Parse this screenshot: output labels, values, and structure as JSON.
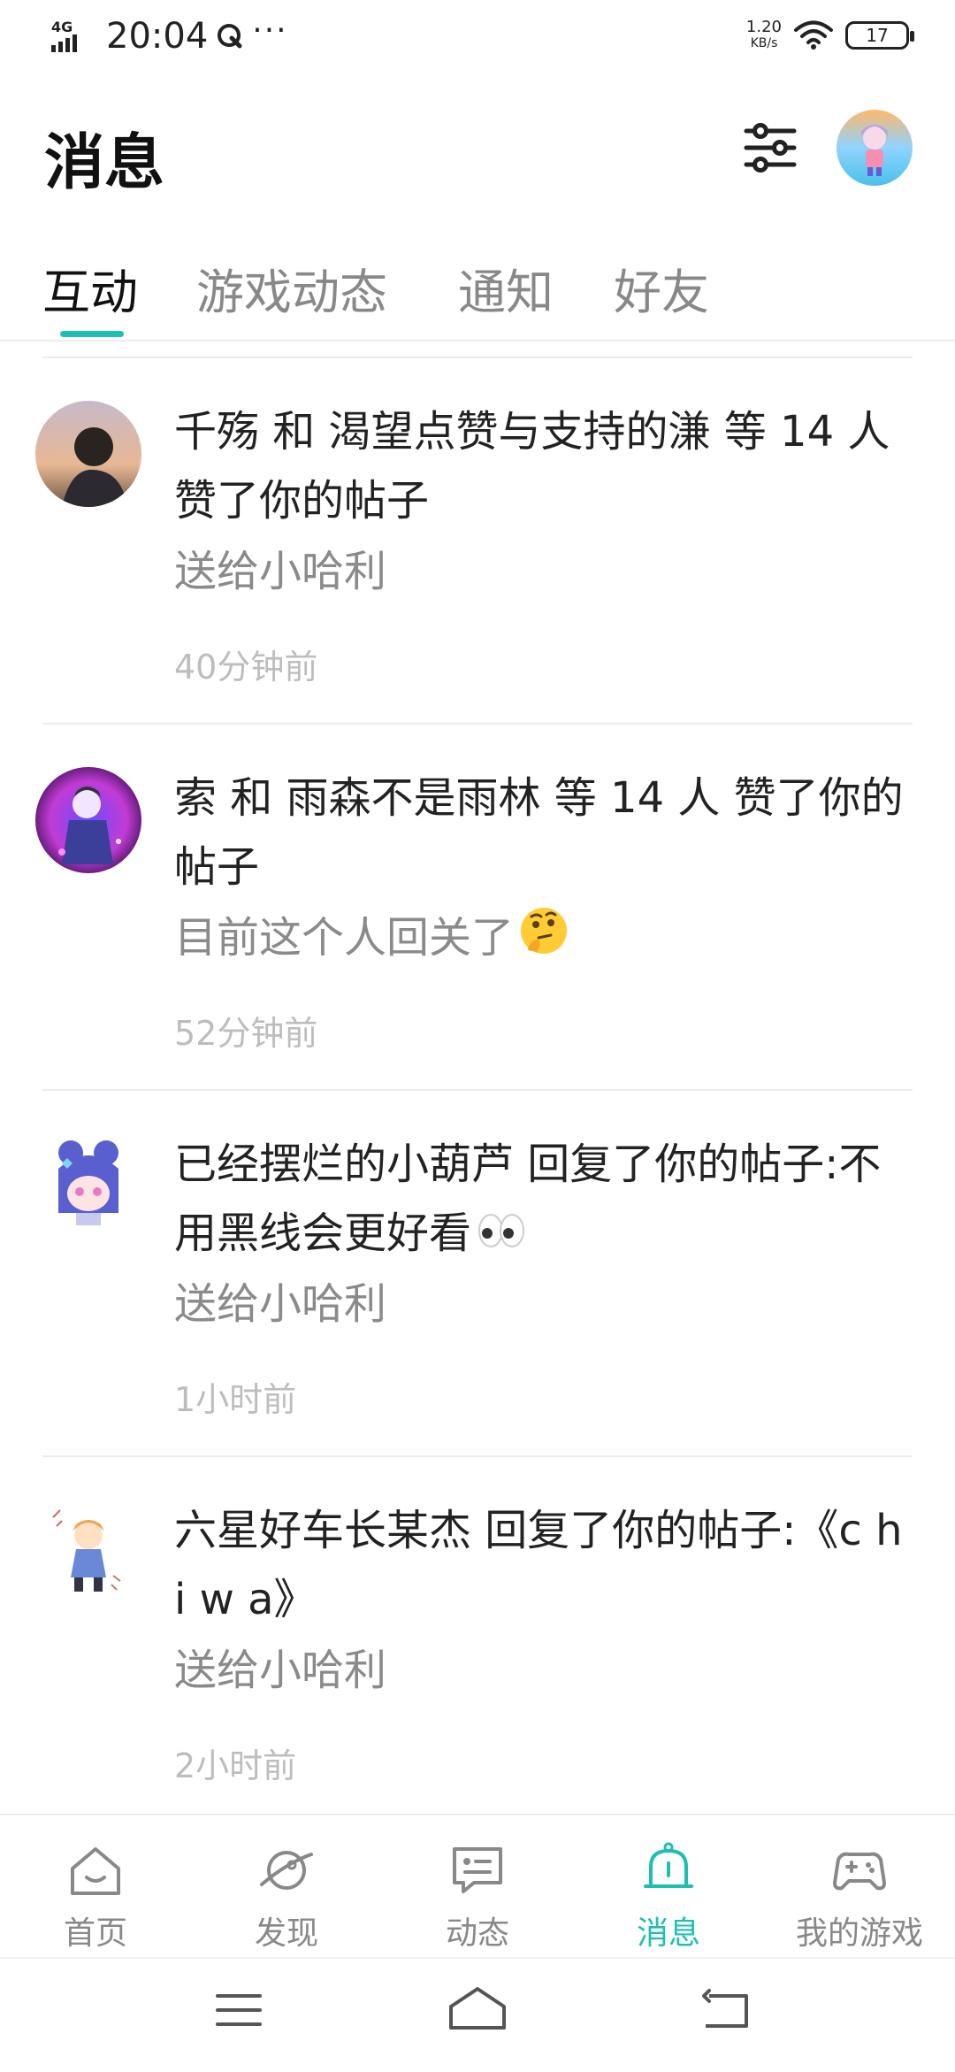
{
  "status_bar": {
    "network": "4G",
    "time": "20:04",
    "more": "···",
    "speed_value": "1.20",
    "speed_unit": "KB/s",
    "battery": "17"
  },
  "header": {
    "title": "消息"
  },
  "tabs": [
    {
      "label": "互动",
      "active": true
    },
    {
      "label": "游戏动态",
      "active": false
    },
    {
      "label": "通知",
      "active": false
    },
    {
      "label": "好友",
      "active": false
    }
  ],
  "messages": [
    {
      "title": "千殇 和 渴望点赞与支持的溓 等 14 人 赞了你的帖子",
      "subtitle": "送给小哈利",
      "time": "40分钟前"
    },
    {
      "title": "索 和 雨森不是雨林 等 14 人 赞了你的帖子",
      "subtitle": "目前这个人回关了",
      "emoji": "thinking-face-emoji",
      "time": "52分钟前"
    },
    {
      "title": "已经摆烂的小葫芦 回复了你的帖子:不用黑线会更好看",
      "emoji": "eyes-emoji",
      "subtitle": "送给小哈利",
      "time": "1小时前"
    },
    {
      "title": "六星好车长某杰 回复了你的帖子:《c h i w a》",
      "subtitle": "送给小哈利",
      "time": "2小时前"
    }
  ],
  "bottom_nav": [
    {
      "label": "首页",
      "icon": "home-icon",
      "active": false
    },
    {
      "label": "发现",
      "icon": "planet-icon",
      "active": false
    },
    {
      "label": "动态",
      "icon": "message-box-icon",
      "active": false
    },
    {
      "label": "消息",
      "icon": "bell-icon",
      "active": true
    },
    {
      "label": "我的游戏",
      "icon": "gamepad-icon",
      "active": false
    }
  ],
  "colors": {
    "accent": "#1dbfb3",
    "text_primary": "#222222",
    "text_secondary": "#8a8a8a",
    "text_time": "#bdbdbd"
  }
}
